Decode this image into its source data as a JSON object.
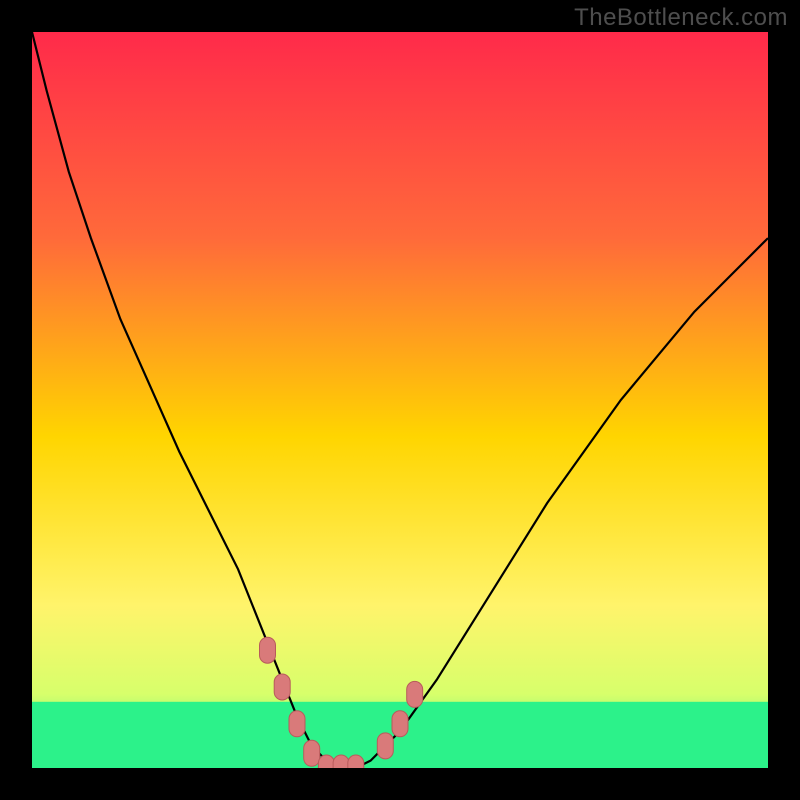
{
  "watermark": "TheBottleneck.com",
  "colors": {
    "frame_bg": "#000000",
    "gradient_top": "#ff2a4a",
    "gradient_mid": "#ffd500",
    "gradient_bottom": "#2cf28a",
    "curve": "#000000",
    "marker_fill": "#d97a7a",
    "marker_stroke": "#b85b5b",
    "watermark": "#4e4e4e"
  },
  "chart_data": {
    "type": "line",
    "title": "",
    "xlabel": "",
    "ylabel": "",
    "xlim": [
      0,
      100
    ],
    "ylim": [
      0,
      100
    ],
    "comment": "Approximate bottleneck curve as visible in the image. Y is normalized 0-100 where 0 is the bottom (green band) and 100 is the top (red).",
    "series": [
      {
        "name": "bottleneck_curve",
        "x": [
          0,
          2,
          5,
          8,
          12,
          16,
          20,
          24,
          28,
          30,
          32,
          34,
          36,
          38,
          40,
          42,
          44,
          46,
          50,
          55,
          60,
          65,
          70,
          75,
          80,
          85,
          90,
          95,
          100
        ],
        "y": [
          100,
          92,
          81,
          72,
          61,
          52,
          43,
          35,
          27,
          22,
          17,
          12,
          7,
          3,
          1,
          0,
          0,
          1,
          5,
          12,
          20,
          28,
          36,
          43,
          50,
          56,
          62,
          67,
          72
        ]
      }
    ],
    "markers": [
      {
        "x": 32,
        "y": 16
      },
      {
        "x": 34,
        "y": 11
      },
      {
        "x": 36,
        "y": 6
      },
      {
        "x": 38,
        "y": 2
      },
      {
        "x": 40,
        "y": 0
      },
      {
        "x": 42,
        "y": 0
      },
      {
        "x": 44,
        "y": 0
      },
      {
        "x": 48,
        "y": 3
      },
      {
        "x": 50,
        "y": 6
      },
      {
        "x": 52,
        "y": 10
      }
    ],
    "green_band": {
      "y_top": 9,
      "y_bottom": 0
    }
  }
}
